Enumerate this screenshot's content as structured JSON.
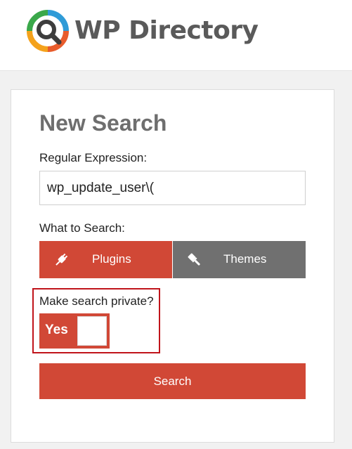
{
  "app": {
    "brand_name": "WP Directory"
  },
  "form": {
    "title": "New Search",
    "regex_label": "Regular Expression:",
    "regex_value": "wp_update_user\\(",
    "search_label": "What to Search:",
    "types": [
      {
        "label": "Plugins",
        "icon": "plug-icon",
        "selected": true
      },
      {
        "label": "Themes",
        "icon": "brush-icon",
        "selected": false
      }
    ],
    "private_label": "Make search private?",
    "private_toggle_label": "Yes",
    "private_enabled": true,
    "submit_label": "Search"
  },
  "colors": {
    "accent": "#d14836",
    "inactive": "#707070",
    "highlight": "#c0141b",
    "logo_text": "#5a5a5a",
    "title": "#6e6e6e"
  }
}
